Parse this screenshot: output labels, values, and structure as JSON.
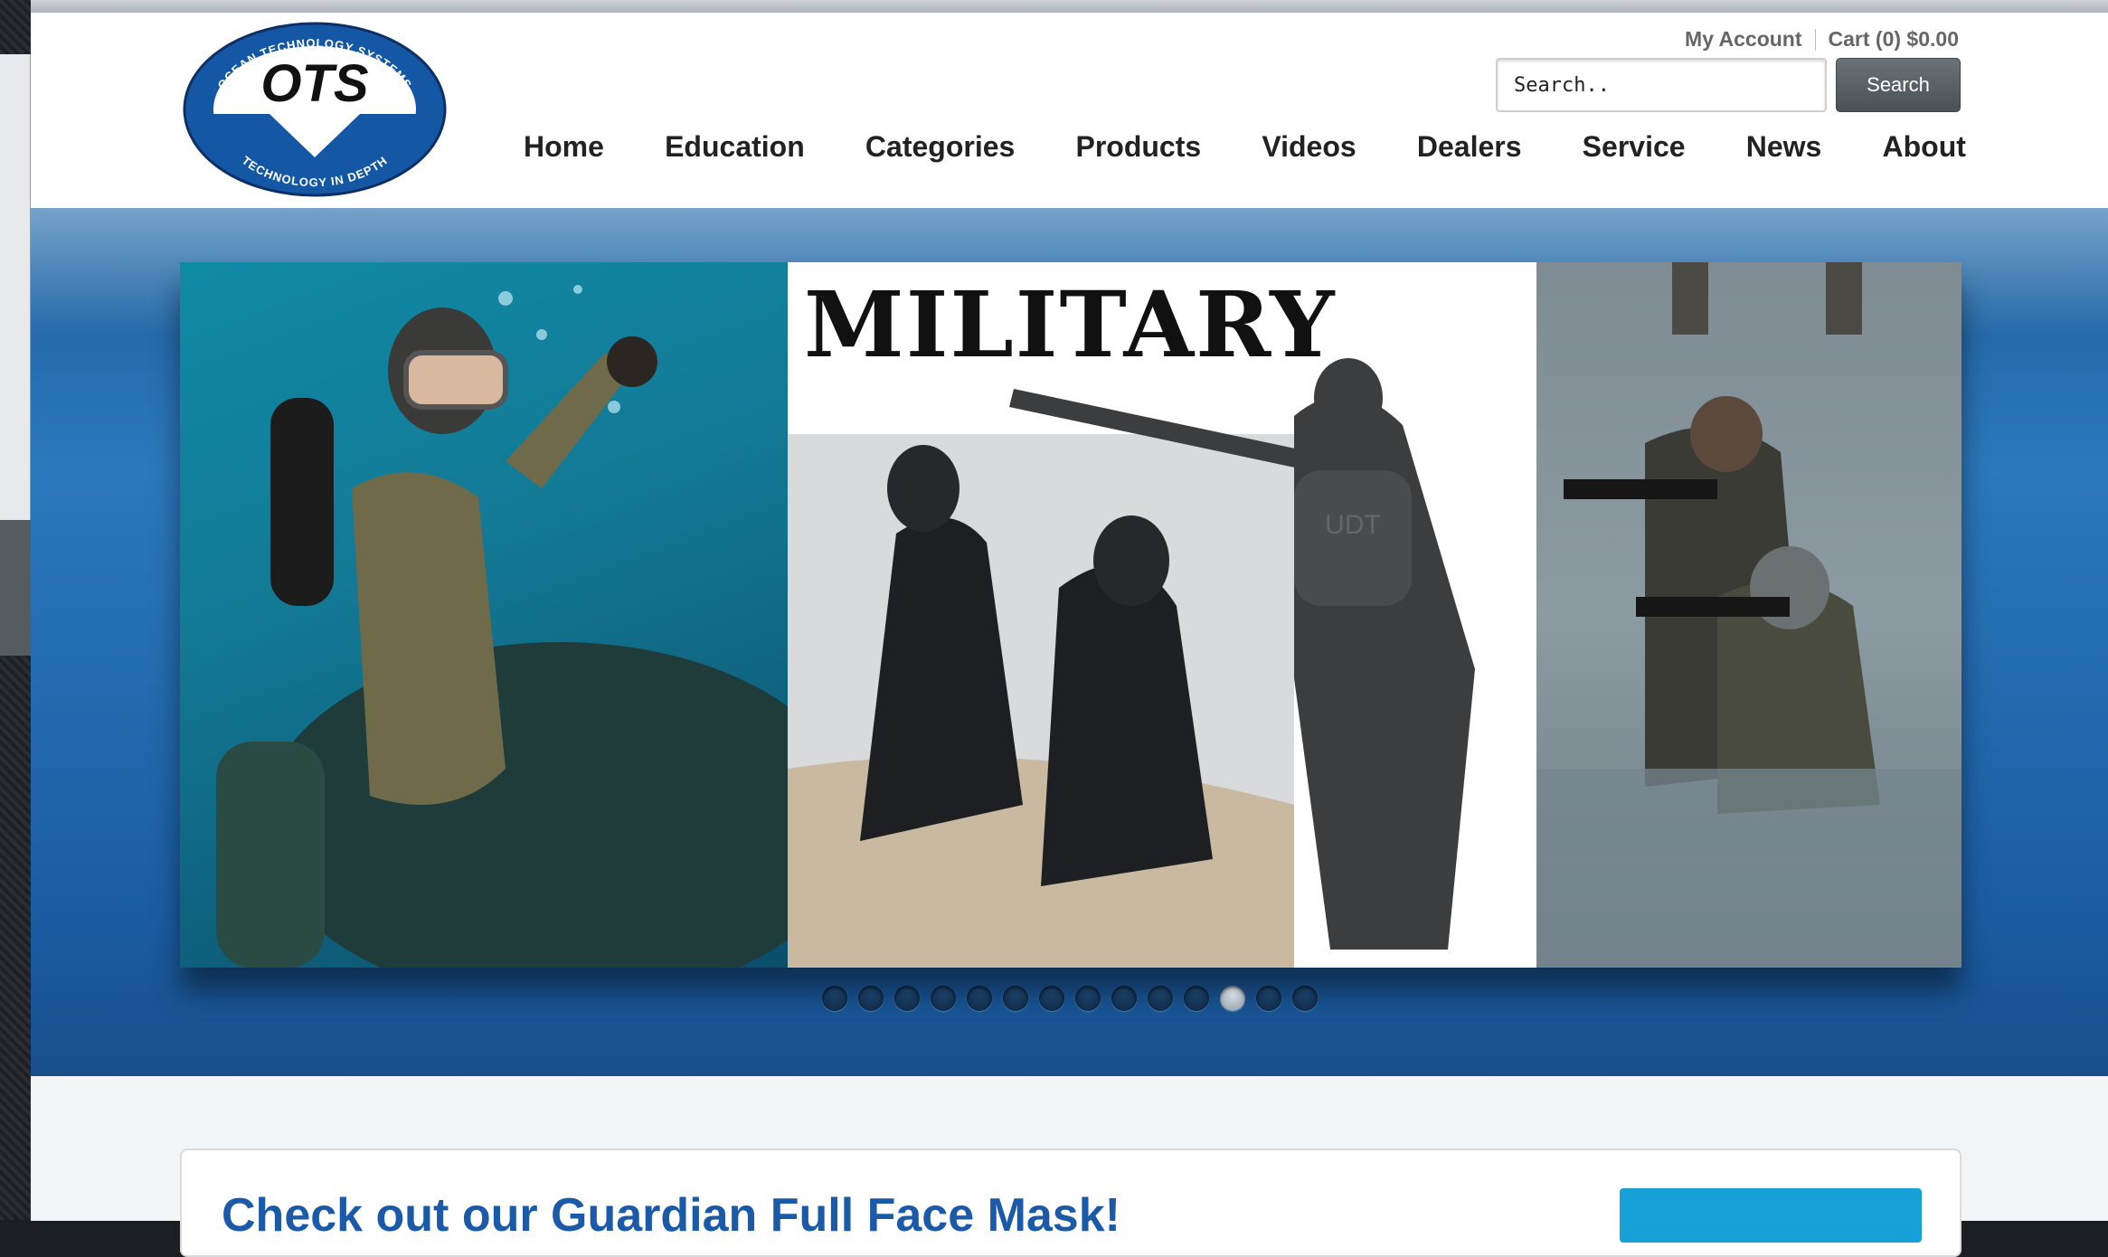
{
  "header": {
    "account_link": "My Account",
    "cart_link": "Cart (0) $0.00",
    "search_placeholder": "Search..",
    "search_button": "Search",
    "logo": {
      "text": "OTS",
      "ring_top": "OCEAN TECHNOLOGY SYSTEMS",
      "ring_bottom": "TECHNOLOGY IN DEPTH"
    }
  },
  "nav": [
    {
      "label": "Home"
    },
    {
      "label": "Education"
    },
    {
      "label": "Categories"
    },
    {
      "label": "Products"
    },
    {
      "label": "Videos"
    },
    {
      "label": "Dealers"
    },
    {
      "label": "Service"
    },
    {
      "label": "News"
    },
    {
      "label": "About"
    }
  ],
  "slider": {
    "title": "MILITARY",
    "panel_badge": "UDT",
    "dot_count": 14,
    "active_dot": 11
  },
  "promo": {
    "title": "Check out our Guardian Full Face Mask!"
  },
  "colors": {
    "hero_blue": "#2c78bd",
    "promo_title": "#1a5aa8",
    "promo_button": "#16a2d8",
    "logo_blue": "#1457a5"
  }
}
